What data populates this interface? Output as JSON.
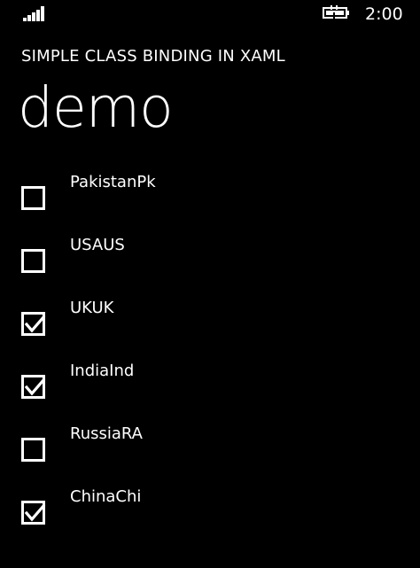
{
  "status_bar": {
    "time": "2:00",
    "signal_icon": "signal-strength-icon",
    "battery_icon": "battery-charging-icon"
  },
  "app_title": "SIMPLE CLASS BINDING IN XAML",
  "page_title": "demo",
  "checklist": [
    {
      "label": "PakistanPk",
      "checked": false
    },
    {
      "label": "USAUS",
      "checked": false
    },
    {
      "label": "UKUK",
      "checked": true
    },
    {
      "label": "IndiaInd",
      "checked": true
    },
    {
      "label": "RussiaRA",
      "checked": false
    },
    {
      "label": "ChinaChi",
      "checked": true
    }
  ],
  "colors": {
    "background": "#000000",
    "foreground": "#ffffff"
  }
}
